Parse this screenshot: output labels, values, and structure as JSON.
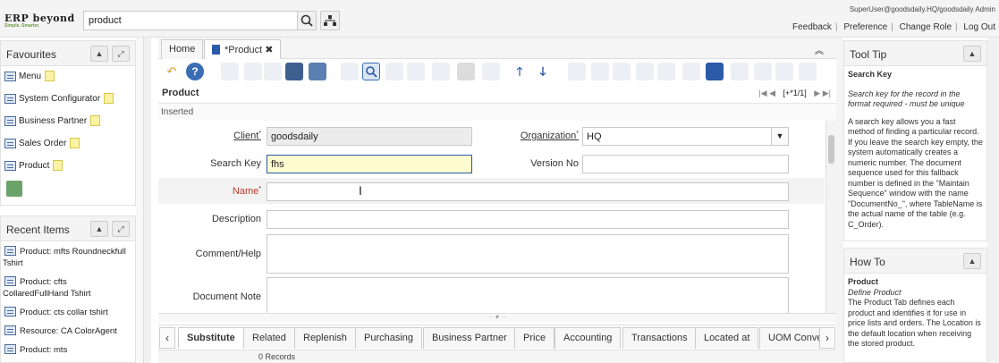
{
  "header": {
    "logo_text": "ERP beyond",
    "logo_tagline": "Simple. Smarter.",
    "search_value": "product",
    "user": "SuperUser@goodsdaily.HQ/goodsdaily Admin",
    "links": [
      "Feedback",
      "Preference",
      "Change Role",
      "Log Out"
    ]
  },
  "favourites": {
    "title": "Favourites",
    "items": [
      "Menu",
      "System Configurator",
      "Business Partner",
      "Sales Order",
      "Product"
    ]
  },
  "recent": {
    "title": "Recent Items",
    "items": [
      "Product: mfts Roundneckfull Tshirt",
      "Product: cfts CollaredFullHand Tshirt",
      "Product: cts collar tshirt",
      "Resource: CA ColorAgent",
      "Product: mts"
    ]
  },
  "tabs": {
    "home": "Home",
    "product": "*Product"
  },
  "window": {
    "title": "Product",
    "nav": "[+*1/1]",
    "status": "Inserted"
  },
  "form": {
    "client_label": "Client",
    "client_value": "goodsdaily",
    "org_label": "Organization",
    "org_value": "HQ",
    "searchkey_label": "Search Key",
    "searchkey_value": "fhs",
    "version_label": "Version No",
    "version_value": "",
    "name_label": "Name",
    "name_value": "",
    "description_label": "Description",
    "comment_label": "Comment/Help",
    "docnote_label": "Document Note"
  },
  "subtabs": [
    "Substitute",
    "Related",
    "Replenish",
    "Purchasing",
    "Business Partner",
    "Price",
    "Accounting",
    "Transactions",
    "Located at",
    "UOM Conve"
  ],
  "records": "0 Records",
  "tooltip": {
    "title": "Tool Tip",
    "field": "Search Key",
    "summary": "Search key for the record in the format required - must be unique",
    "detail": "A search key allows you a fast method of finding a particular record. If you leave the search key empty, the system automatically creates a numeric number. The document sequence used for this fallback number is defined in the \"Maintain Sequence\" window with the name \"DocumentNo_\", where TableName is the actual name of the table (e.g. C_Order)."
  },
  "howto": {
    "title": "How To",
    "name": "Product",
    "subtitle": "Define Product",
    "text": "The Product Tab defines each product and identifies it for use in price lists and orders. The Location is the default location when receiving the stored product."
  }
}
